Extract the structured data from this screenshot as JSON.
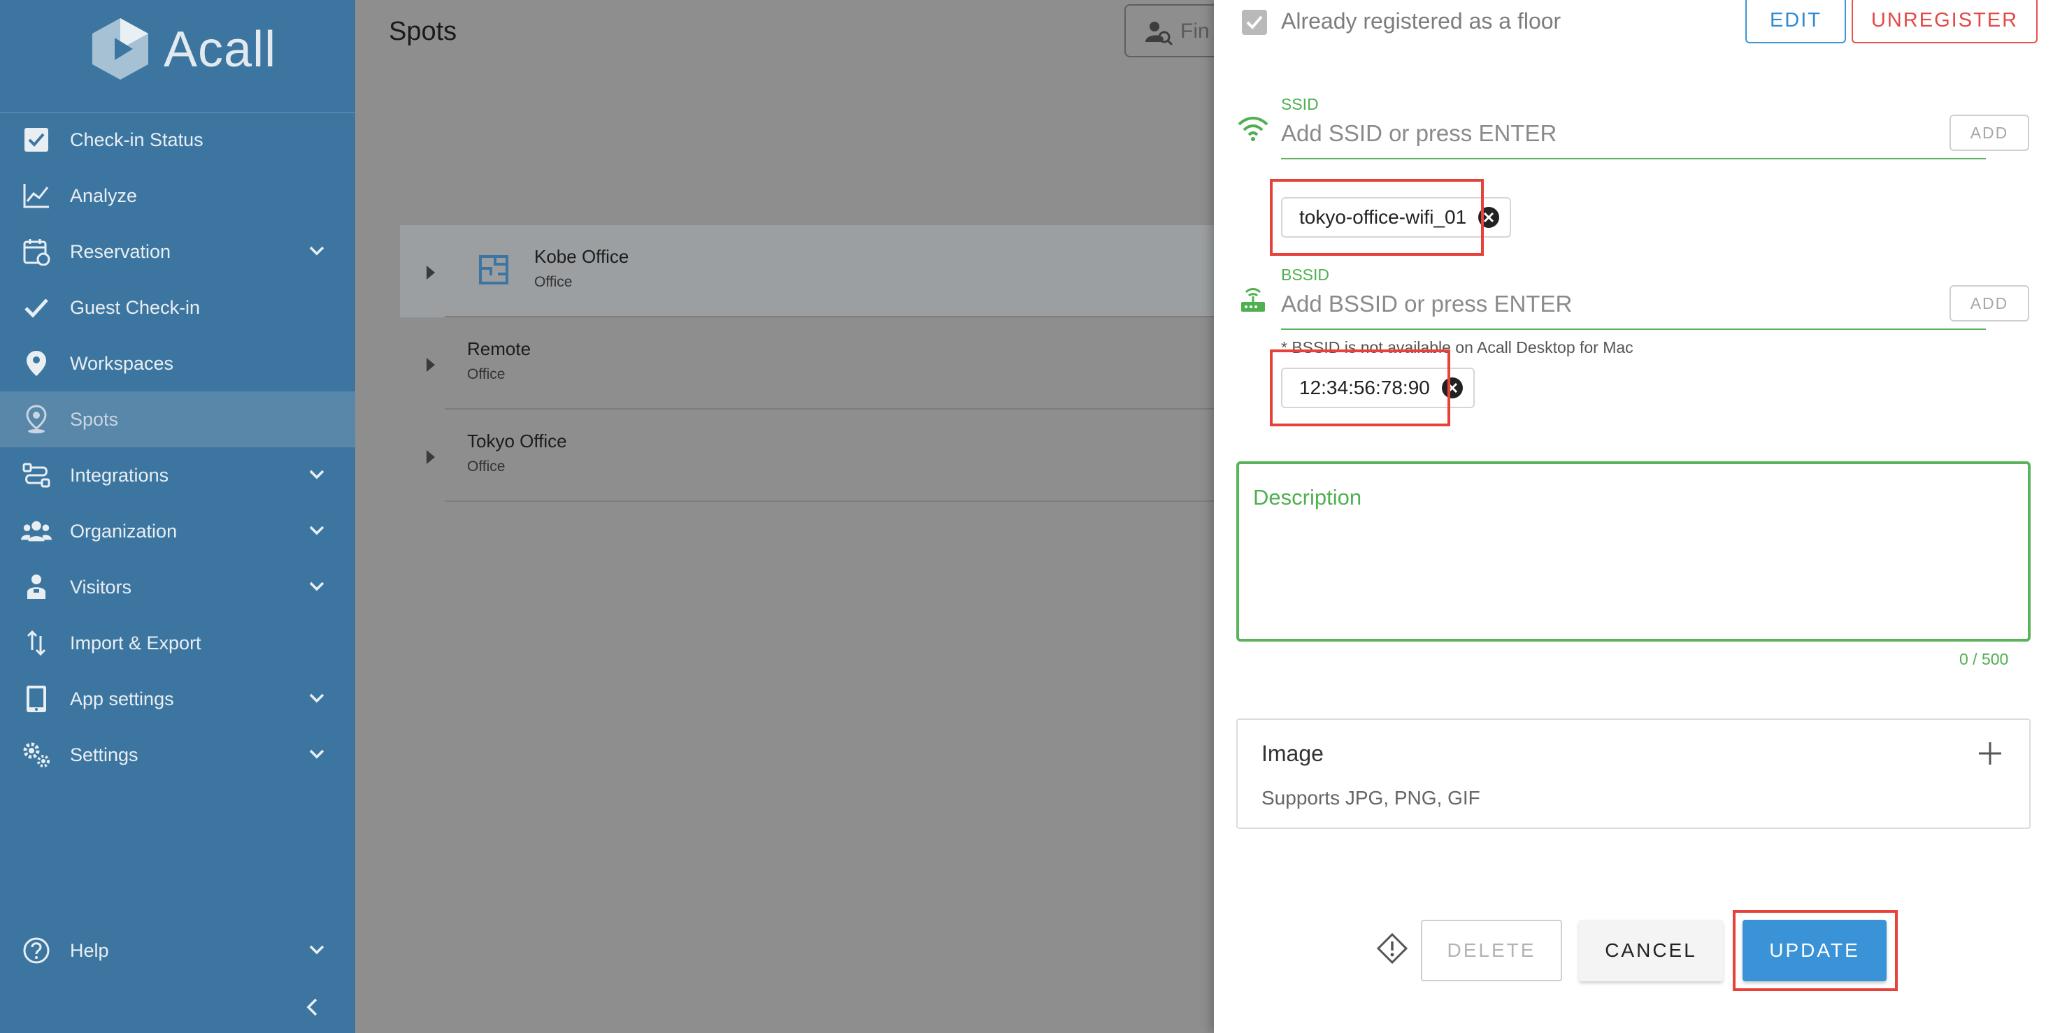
{
  "app": {
    "logo_text": "Acall"
  },
  "sidebar": {
    "items": [
      {
        "label": "Check-in Status",
        "icon": "checkbox-icon"
      },
      {
        "label": "Analyze",
        "icon": "chart-line-icon"
      },
      {
        "label": "Reservation",
        "icon": "calendar-icon",
        "expandable": true
      },
      {
        "label": "Guest Check-in",
        "icon": "check-icon"
      },
      {
        "label": "Workspaces",
        "icon": "map-pin-icon"
      },
      {
        "label": "Spots",
        "icon": "location-pin-icon",
        "active": true
      },
      {
        "label": "Integrations",
        "icon": "integration-icon",
        "expandable": true
      },
      {
        "label": "Organization",
        "icon": "people-icon",
        "expandable": true
      },
      {
        "label": "Visitors",
        "icon": "visitor-icon",
        "expandable": true
      },
      {
        "label": "Import & Export",
        "icon": "import-export-icon"
      },
      {
        "label": "App settings",
        "icon": "tablet-icon",
        "expandable": true
      },
      {
        "label": "Settings",
        "icon": "gears-icon",
        "expandable": true
      }
    ],
    "help_label": "Help"
  },
  "main": {
    "title": "Spots",
    "search_text": "Fin",
    "spots": [
      {
        "name": "Kobe Office",
        "type": "Office"
      },
      {
        "name": "Remote",
        "type": "Office"
      },
      {
        "name": "Tokyo Office",
        "type": "Office"
      }
    ]
  },
  "panel": {
    "registered_label": "Already registered as a floor",
    "edit_label": "EDIT",
    "unregister_label": "UNREGISTER",
    "ssid": {
      "label": "SSID",
      "placeholder": "Add SSID or press ENTER",
      "add_label": "ADD",
      "chips": [
        "tokyo-office-wifi_01"
      ]
    },
    "bssid": {
      "label": "BSSID",
      "placeholder": "Add BSSID or press ENTER",
      "add_label": "ADD",
      "note": "* BSSID is not available on Acall Desktop for Mac",
      "chips": [
        "12:34:56:78:90"
      ]
    },
    "description": {
      "placeholder": "Description",
      "counter": "0 / 500"
    },
    "image": {
      "title": "Image",
      "subtitle": "Supports JPG, PNG, GIF"
    },
    "actions": {
      "delete_label": "DELETE",
      "cancel_label": "CANCEL",
      "update_label": "UPDATE"
    }
  },
  "colors": {
    "sidebar_bg": "#3c76a0",
    "accent_green": "#4fb050",
    "primary_blue": "#3b93d7",
    "danger_red": "#e34a46",
    "highlight_red": "#e6423a"
  }
}
